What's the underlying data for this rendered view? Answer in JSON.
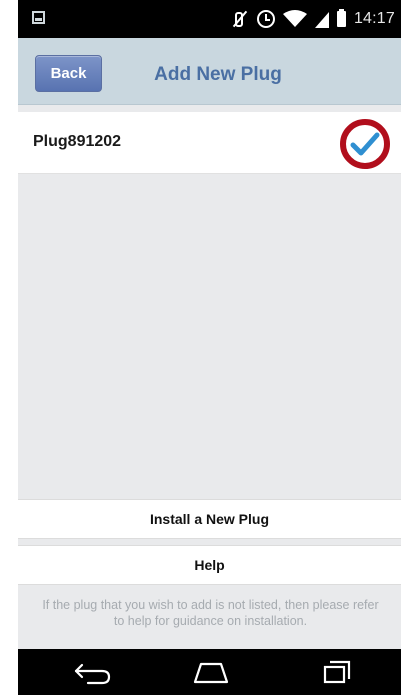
{
  "status_bar": {
    "time": "14:17",
    "icons": [
      "screenshot-icon",
      "mute-icon",
      "alarm-icon",
      "wifi-icon",
      "signal-icon",
      "battery-icon"
    ]
  },
  "header": {
    "back_label": "Back",
    "title": "Add New Plug"
  },
  "plugs": [
    {
      "name": "Plug891202",
      "selected": true
    }
  ],
  "actions": {
    "install_label": "Install a New Plug",
    "help_label": "Help"
  },
  "info_text": "If the plug that you wish to add is not listed, then please refer to help for guidance on installation.",
  "navigation": {
    "icons": [
      "back-nav-icon",
      "home-nav-icon",
      "recents-nav-icon"
    ]
  },
  "colors": {
    "header_bg": "#c9d7df",
    "title": "#4a6fa3",
    "back_button": "#6780bd",
    "check": "#2f8fd1",
    "highlight_ring": "#b10e1c"
  }
}
